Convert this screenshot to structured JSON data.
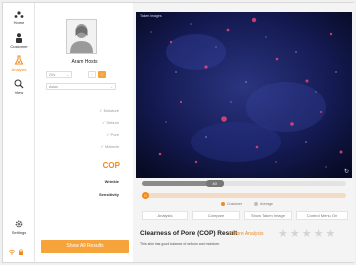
{
  "nav": {
    "items": [
      {
        "label": "Home",
        "icon": "home-icon"
      },
      {
        "label": "Customer",
        "icon": "customer-icon"
      },
      {
        "label": "Analysis",
        "icon": "analysis-icon",
        "active": true
      },
      {
        "label": "View",
        "icon": "view-icon"
      },
      {
        "label": "Settings",
        "icon": "settings-icon"
      }
    ],
    "accent": "#f08a1c"
  },
  "profile": {
    "name": "Aram Hosts",
    "age_select": "20's",
    "skin_select": "Asian",
    "gender_male": "♂",
    "gender_female": "♀"
  },
  "metrics": {
    "moisture": "Moisture",
    "sebum": "Sebum",
    "pore": "Pore",
    "melanin": "Melanin",
    "current": "COP",
    "wrinkle": "Wrinkle",
    "sensitivity": "Sensitivity"
  },
  "show_all_button": "Show All Results",
  "viewer": {
    "label": "Taken images",
    "rotate_icon": "rotate-icon"
  },
  "slider": {
    "top_value": "40",
    "top_value_fraction": 0.4,
    "bottom_value": "0",
    "bottom_value_fraction": 0.0
  },
  "legend": {
    "customer": "Customer",
    "average": "Average",
    "customer_color": "#f08a1c",
    "average_color": "#bdbdbd"
  },
  "actions": {
    "analysis": "Analysis",
    "compare": "Compare",
    "show_taken": "Show Taken Image",
    "control_menu": "Control Menu On"
  },
  "result": {
    "title": "Clearness of Pore (COP) Result",
    "link": "Before Analysis",
    "description": "This skin has good balance of sebum and moisture.",
    "stars": "★★★★★",
    "rating": 0
  }
}
